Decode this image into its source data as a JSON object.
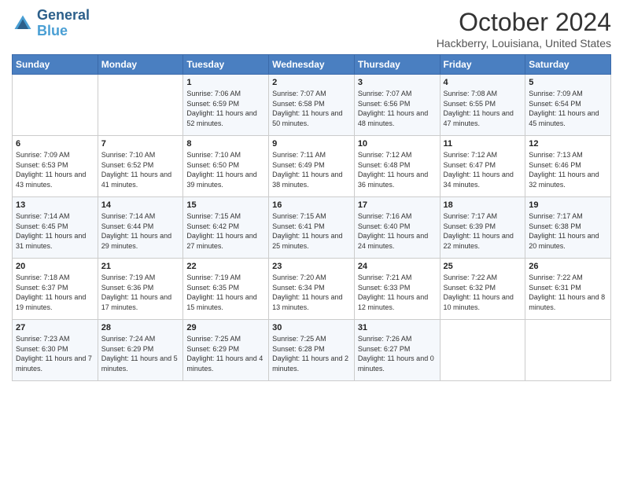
{
  "logo": {
    "line1": "General",
    "line2": "Blue"
  },
  "title": "October 2024",
  "location": "Hackberry, Louisiana, United States",
  "days_of_week": [
    "Sunday",
    "Monday",
    "Tuesday",
    "Wednesday",
    "Thursday",
    "Friday",
    "Saturday"
  ],
  "weeks": [
    [
      {
        "day": "",
        "sunrise": "",
        "sunset": "",
        "daylight": ""
      },
      {
        "day": "",
        "sunrise": "",
        "sunset": "",
        "daylight": ""
      },
      {
        "day": "1",
        "sunrise": "Sunrise: 7:06 AM",
        "sunset": "Sunset: 6:59 PM",
        "daylight": "Daylight: 11 hours and 52 minutes."
      },
      {
        "day": "2",
        "sunrise": "Sunrise: 7:07 AM",
        "sunset": "Sunset: 6:58 PM",
        "daylight": "Daylight: 11 hours and 50 minutes."
      },
      {
        "day": "3",
        "sunrise": "Sunrise: 7:07 AM",
        "sunset": "Sunset: 6:56 PM",
        "daylight": "Daylight: 11 hours and 48 minutes."
      },
      {
        "day": "4",
        "sunrise": "Sunrise: 7:08 AM",
        "sunset": "Sunset: 6:55 PM",
        "daylight": "Daylight: 11 hours and 47 minutes."
      },
      {
        "day": "5",
        "sunrise": "Sunrise: 7:09 AM",
        "sunset": "Sunset: 6:54 PM",
        "daylight": "Daylight: 11 hours and 45 minutes."
      }
    ],
    [
      {
        "day": "6",
        "sunrise": "Sunrise: 7:09 AM",
        "sunset": "Sunset: 6:53 PM",
        "daylight": "Daylight: 11 hours and 43 minutes."
      },
      {
        "day": "7",
        "sunrise": "Sunrise: 7:10 AM",
        "sunset": "Sunset: 6:52 PM",
        "daylight": "Daylight: 11 hours and 41 minutes."
      },
      {
        "day": "8",
        "sunrise": "Sunrise: 7:10 AM",
        "sunset": "Sunset: 6:50 PM",
        "daylight": "Daylight: 11 hours and 39 minutes."
      },
      {
        "day": "9",
        "sunrise": "Sunrise: 7:11 AM",
        "sunset": "Sunset: 6:49 PM",
        "daylight": "Daylight: 11 hours and 38 minutes."
      },
      {
        "day": "10",
        "sunrise": "Sunrise: 7:12 AM",
        "sunset": "Sunset: 6:48 PM",
        "daylight": "Daylight: 11 hours and 36 minutes."
      },
      {
        "day": "11",
        "sunrise": "Sunrise: 7:12 AM",
        "sunset": "Sunset: 6:47 PM",
        "daylight": "Daylight: 11 hours and 34 minutes."
      },
      {
        "day": "12",
        "sunrise": "Sunrise: 7:13 AM",
        "sunset": "Sunset: 6:46 PM",
        "daylight": "Daylight: 11 hours and 32 minutes."
      }
    ],
    [
      {
        "day": "13",
        "sunrise": "Sunrise: 7:14 AM",
        "sunset": "Sunset: 6:45 PM",
        "daylight": "Daylight: 11 hours and 31 minutes."
      },
      {
        "day": "14",
        "sunrise": "Sunrise: 7:14 AM",
        "sunset": "Sunset: 6:44 PM",
        "daylight": "Daylight: 11 hours and 29 minutes."
      },
      {
        "day": "15",
        "sunrise": "Sunrise: 7:15 AM",
        "sunset": "Sunset: 6:42 PM",
        "daylight": "Daylight: 11 hours and 27 minutes."
      },
      {
        "day": "16",
        "sunrise": "Sunrise: 7:15 AM",
        "sunset": "Sunset: 6:41 PM",
        "daylight": "Daylight: 11 hours and 25 minutes."
      },
      {
        "day": "17",
        "sunrise": "Sunrise: 7:16 AM",
        "sunset": "Sunset: 6:40 PM",
        "daylight": "Daylight: 11 hours and 24 minutes."
      },
      {
        "day": "18",
        "sunrise": "Sunrise: 7:17 AM",
        "sunset": "Sunset: 6:39 PM",
        "daylight": "Daylight: 11 hours and 22 minutes."
      },
      {
        "day": "19",
        "sunrise": "Sunrise: 7:17 AM",
        "sunset": "Sunset: 6:38 PM",
        "daylight": "Daylight: 11 hours and 20 minutes."
      }
    ],
    [
      {
        "day": "20",
        "sunrise": "Sunrise: 7:18 AM",
        "sunset": "Sunset: 6:37 PM",
        "daylight": "Daylight: 11 hours and 19 minutes."
      },
      {
        "day": "21",
        "sunrise": "Sunrise: 7:19 AM",
        "sunset": "Sunset: 6:36 PM",
        "daylight": "Daylight: 11 hours and 17 minutes."
      },
      {
        "day": "22",
        "sunrise": "Sunrise: 7:19 AM",
        "sunset": "Sunset: 6:35 PM",
        "daylight": "Daylight: 11 hours and 15 minutes."
      },
      {
        "day": "23",
        "sunrise": "Sunrise: 7:20 AM",
        "sunset": "Sunset: 6:34 PM",
        "daylight": "Daylight: 11 hours and 13 minutes."
      },
      {
        "day": "24",
        "sunrise": "Sunrise: 7:21 AM",
        "sunset": "Sunset: 6:33 PM",
        "daylight": "Daylight: 11 hours and 12 minutes."
      },
      {
        "day": "25",
        "sunrise": "Sunrise: 7:22 AM",
        "sunset": "Sunset: 6:32 PM",
        "daylight": "Daylight: 11 hours and 10 minutes."
      },
      {
        "day": "26",
        "sunrise": "Sunrise: 7:22 AM",
        "sunset": "Sunset: 6:31 PM",
        "daylight": "Daylight: 11 hours and 8 minutes."
      }
    ],
    [
      {
        "day": "27",
        "sunrise": "Sunrise: 7:23 AM",
        "sunset": "Sunset: 6:30 PM",
        "daylight": "Daylight: 11 hours and 7 minutes."
      },
      {
        "day": "28",
        "sunrise": "Sunrise: 7:24 AM",
        "sunset": "Sunset: 6:29 PM",
        "daylight": "Daylight: 11 hours and 5 minutes."
      },
      {
        "day": "29",
        "sunrise": "Sunrise: 7:25 AM",
        "sunset": "Sunset: 6:29 PM",
        "daylight": "Daylight: 11 hours and 4 minutes."
      },
      {
        "day": "30",
        "sunrise": "Sunrise: 7:25 AM",
        "sunset": "Sunset: 6:28 PM",
        "daylight": "Daylight: 11 hours and 2 minutes."
      },
      {
        "day": "31",
        "sunrise": "Sunrise: 7:26 AM",
        "sunset": "Sunset: 6:27 PM",
        "daylight": "Daylight: 11 hours and 0 minutes."
      },
      {
        "day": "",
        "sunrise": "",
        "sunset": "",
        "daylight": ""
      },
      {
        "day": "",
        "sunrise": "",
        "sunset": "",
        "daylight": ""
      }
    ]
  ]
}
